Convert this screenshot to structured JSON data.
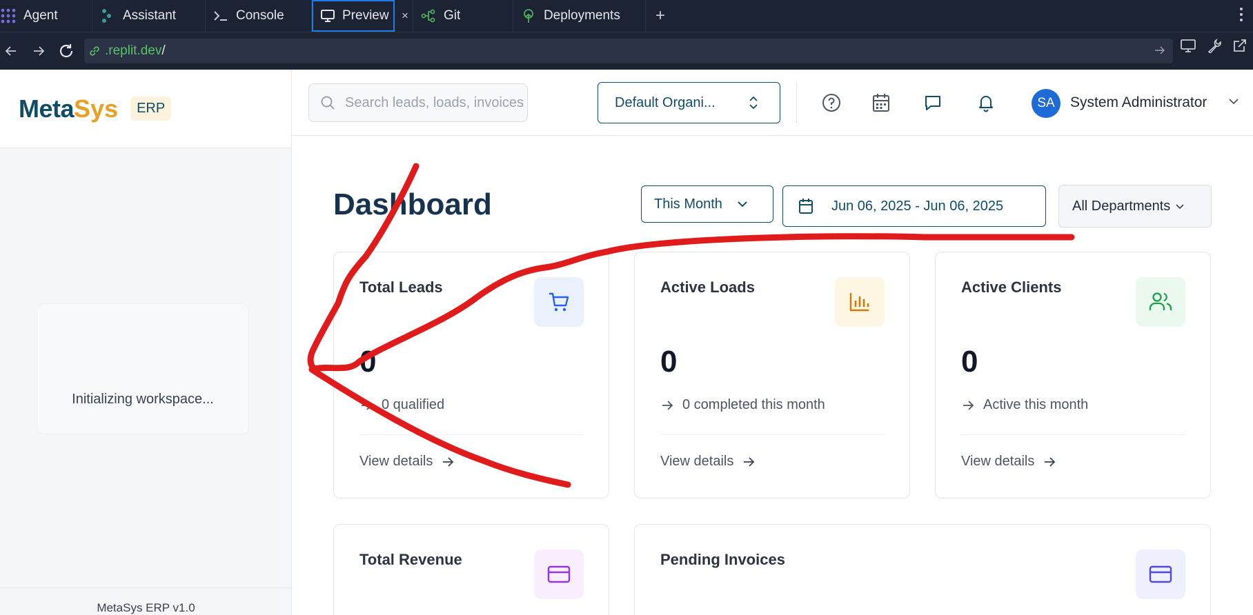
{
  "ide": {
    "tabs": [
      {
        "label": "Agent",
        "icon": "agent-icon"
      },
      {
        "label": "Assistant",
        "icon": "assistant-icon"
      },
      {
        "label": "Console",
        "icon": "console-icon"
      },
      {
        "label": "Preview",
        "icon": "monitor-icon",
        "active": true
      },
      {
        "label": "Git",
        "icon": "git-icon"
      },
      {
        "label": "Deployments",
        "icon": "deployments-icon"
      }
    ],
    "close_label": "×",
    "add_label": "+",
    "url_host": ".replit.dev",
    "url_path": "/",
    "active_color": "#1e7be8"
  },
  "sidebar": {
    "brand_meta": "Meta",
    "brand_sys": "Sys",
    "brand_badge": "ERP",
    "loading_text": "Initializing workspace...",
    "footer": "MetaSys ERP v1.0"
  },
  "header": {
    "search_placeholder": "Search leads, loads, invoices...",
    "organization": "Default Organi...",
    "user_initials": "SA",
    "user_name": "System Administrator"
  },
  "dashboard": {
    "title": "Dashboard",
    "range": "This Month",
    "date_range": "Jun 06, 2025 - Jun 06, 2025",
    "department": "All Departments",
    "cards": [
      {
        "title": "Total Leads",
        "value": "0",
        "sub": "0 qualified",
        "link": "View details",
        "icon": "cart-icon"
      },
      {
        "title": "Active Loads",
        "value": "0",
        "sub": "0 completed this month",
        "link": "View details",
        "icon": "bar-chart-icon"
      },
      {
        "title": "Active Clients",
        "value": "0",
        "sub": "Active this month",
        "link": "View details",
        "icon": "users-icon"
      },
      {
        "title": "Total Revenue",
        "icon": "credit-card-icon"
      },
      {
        "title": "Pending Invoices",
        "icon": "credit-card-icon"
      }
    ]
  },
  "colors": {
    "brand_navy": "#0f4c6b",
    "brand_gold": "#e8a025",
    "annotation_red": "#e01b1b",
    "avatar_blue": "#1e6ad6"
  }
}
